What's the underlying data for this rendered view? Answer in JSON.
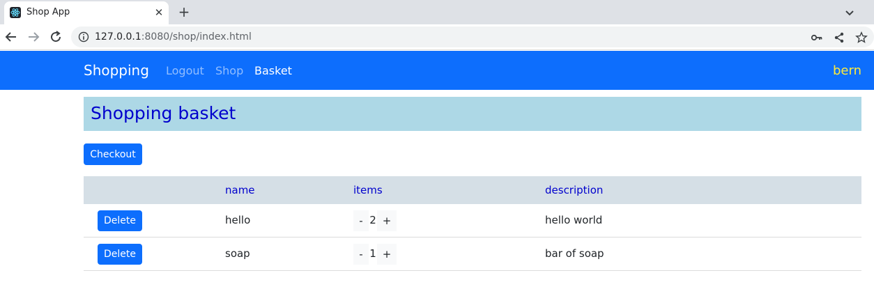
{
  "browser": {
    "tab_title": "Shop App",
    "tab_close": "✕",
    "new_tab": "+",
    "url_host": "127.0.0.1",
    "url_rest": ":8080/shop/index.html"
  },
  "navbar": {
    "brand": "Shopping",
    "links": [
      {
        "label": "Logout",
        "active": false
      },
      {
        "label": "Shop",
        "active": false
      },
      {
        "label": "Basket",
        "active": true
      }
    ],
    "user": "bern",
    "background_color": "#0d6efd",
    "user_color": "#ffeb3b"
  },
  "page": {
    "heading": "Shopping basket",
    "checkout_label": "Checkout"
  },
  "basket_table": {
    "columns": [
      "",
      "name",
      "items",
      "description"
    ],
    "rows": [
      {
        "delete_label": "Delete",
        "name": "hello",
        "items": "2",
        "description": "hello world",
        "minus": "-",
        "plus": "+"
      },
      {
        "delete_label": "Delete",
        "name": "soap",
        "items": "1",
        "description": "bar of soap",
        "minus": "-",
        "plus": "+"
      }
    ]
  }
}
